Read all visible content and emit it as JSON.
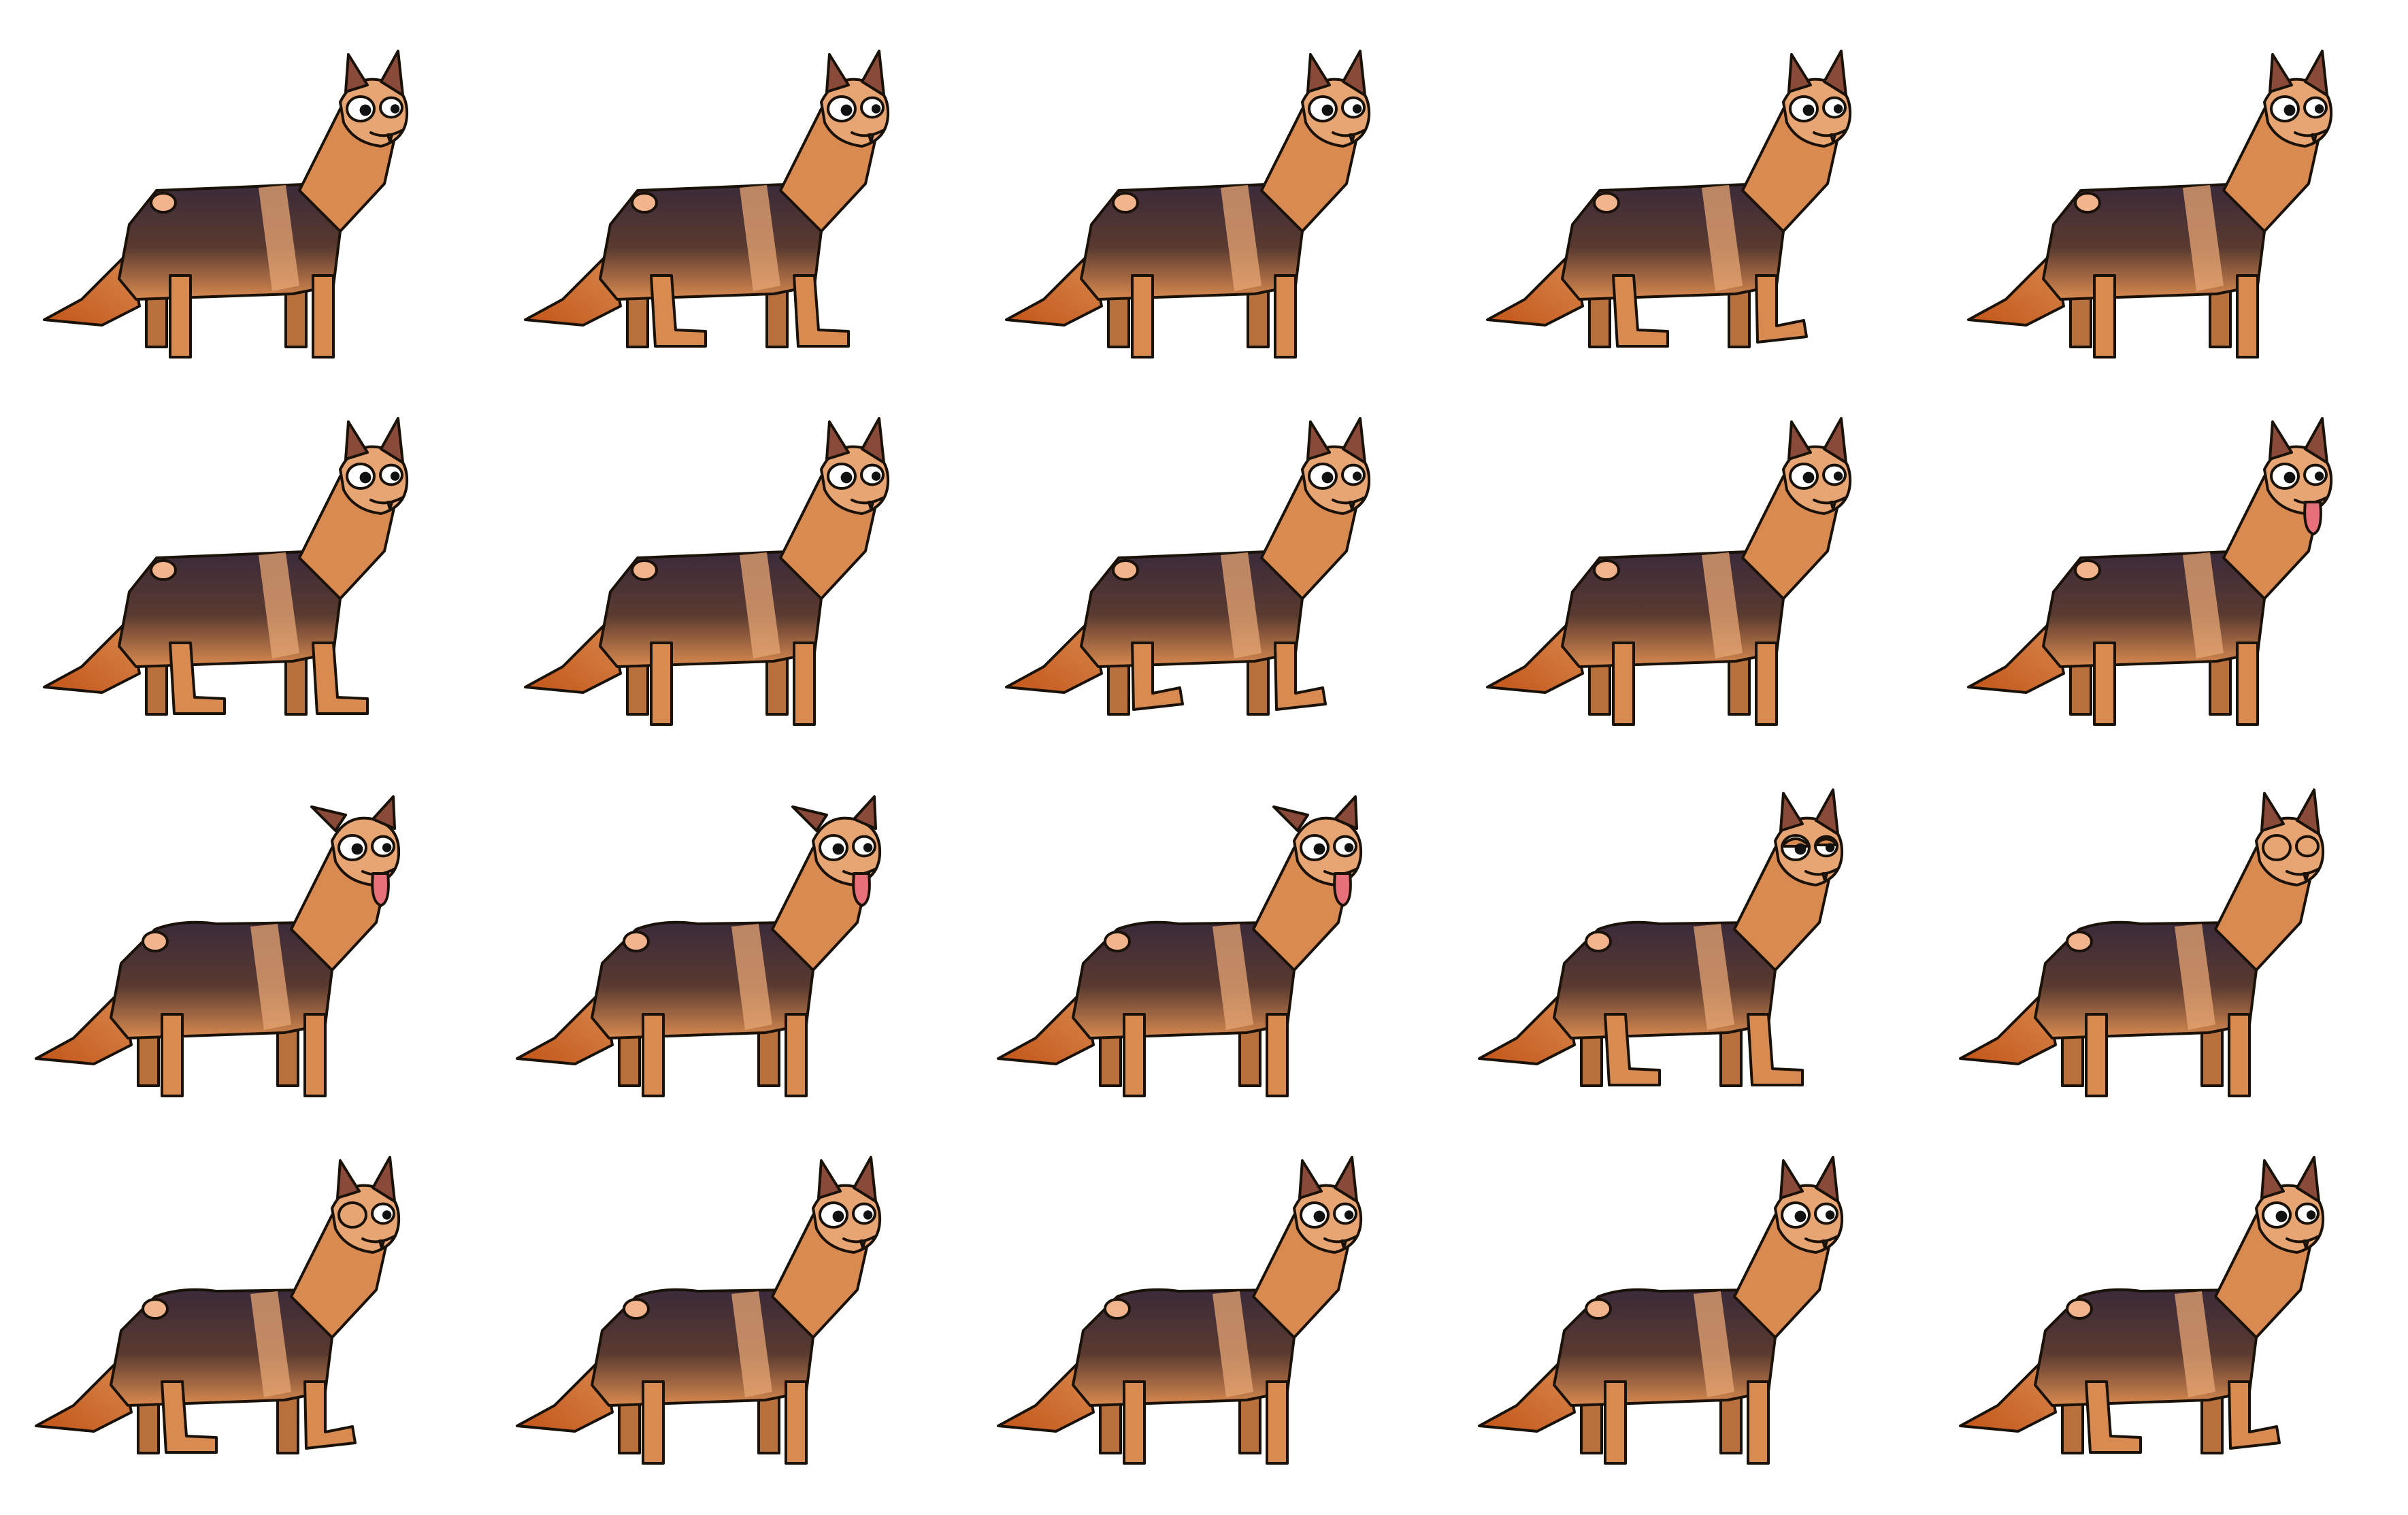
{
  "sprite_sheet": {
    "rows": 4,
    "columns": 5,
    "colors": {
      "background": "#ffffff",
      "fur_tan": "#d98a50",
      "fur_tan_light": "#e7a574",
      "fur_dark": "#3a2a3a",
      "tail_tip": "#c25418",
      "ear_inner": "#8a4a3a",
      "outline": "#1a1208",
      "tongue": "#e8707a",
      "spot": "#f2b48c"
    },
    "frames": [
      {
        "pose": "stand",
        "lift_back": 0,
        "lift_front": 0,
        "tongue": false,
        "eye": "open",
        "ears": "up",
        "hump": 0
      },
      {
        "pose": "walk",
        "lift_back": 1,
        "lift_front": 1,
        "tongue": false,
        "eye": "open",
        "ears": "up",
        "hump": 0
      },
      {
        "pose": "stand",
        "lift_back": 0,
        "lift_front": 0,
        "tongue": false,
        "eye": "open",
        "ears": "up",
        "hump": 0
      },
      {
        "pose": "walk",
        "lift_back": 1,
        "lift_front": 2,
        "tongue": false,
        "eye": "open",
        "ears": "up",
        "hump": 0
      },
      {
        "pose": "stand",
        "lift_back": 0,
        "lift_front": 0,
        "tongue": false,
        "eye": "open",
        "ears": "up",
        "hump": 0
      },
      {
        "pose": "walk",
        "lift_back": 1,
        "lift_front": 1,
        "tongue": false,
        "eye": "open",
        "ears": "up",
        "hump": 0
      },
      {
        "pose": "stand",
        "lift_back": 0,
        "lift_front": 0,
        "tongue": false,
        "eye": "open",
        "ears": "up",
        "hump": 0
      },
      {
        "pose": "walk",
        "lift_back": 2,
        "lift_front": 2,
        "tongue": false,
        "eye": "open",
        "ears": "up",
        "hump": 0
      },
      {
        "pose": "stand",
        "lift_back": 0,
        "lift_front": 0,
        "tongue": false,
        "eye": "open",
        "ears": "up",
        "hump": 0
      },
      {
        "pose": "stand",
        "lift_back": 0,
        "lift_front": 0,
        "tongue": true,
        "eye": "open",
        "ears": "up",
        "hump": 0
      },
      {
        "pose": "stand",
        "lift_back": 0,
        "lift_front": 0,
        "tongue": true,
        "eye": "open",
        "ears": "floppy",
        "hump": 1
      },
      {
        "pose": "stand",
        "lift_back": 0,
        "lift_front": 0,
        "tongue": true,
        "eye": "open",
        "ears": "floppy",
        "hump": 1
      },
      {
        "pose": "stand",
        "lift_back": 0,
        "lift_front": 0,
        "tongue": true,
        "eye": "open",
        "ears": "floppy",
        "hump": 1
      },
      {
        "pose": "walk",
        "lift_back": 1,
        "lift_front": 1,
        "tongue": false,
        "eye": "sleepy",
        "ears": "up",
        "hump": 1
      },
      {
        "pose": "stand",
        "lift_back": 0,
        "lift_front": 0,
        "tongue": false,
        "eye": "blink",
        "ears": "up",
        "hump": 1
      },
      {
        "pose": "walk",
        "lift_back": 1,
        "lift_front": 2,
        "tongue": false,
        "eye": "wink",
        "ears": "up",
        "hump": 1
      },
      {
        "pose": "stand",
        "lift_back": 0,
        "lift_front": 0,
        "tongue": false,
        "eye": "open",
        "ears": "up",
        "hump": 1
      },
      {
        "pose": "stand",
        "lift_back": 0,
        "lift_front": 0,
        "tongue": false,
        "eye": "open",
        "ears": "up",
        "hump": 1
      },
      {
        "pose": "stand",
        "lift_back": 0,
        "lift_front": 0,
        "tongue": false,
        "eye": "open",
        "ears": "up",
        "hump": 1
      },
      {
        "pose": "walk",
        "lift_back": 1,
        "lift_front": 2,
        "tongue": false,
        "eye": "open",
        "ears": "up",
        "hump": 1
      }
    ]
  }
}
